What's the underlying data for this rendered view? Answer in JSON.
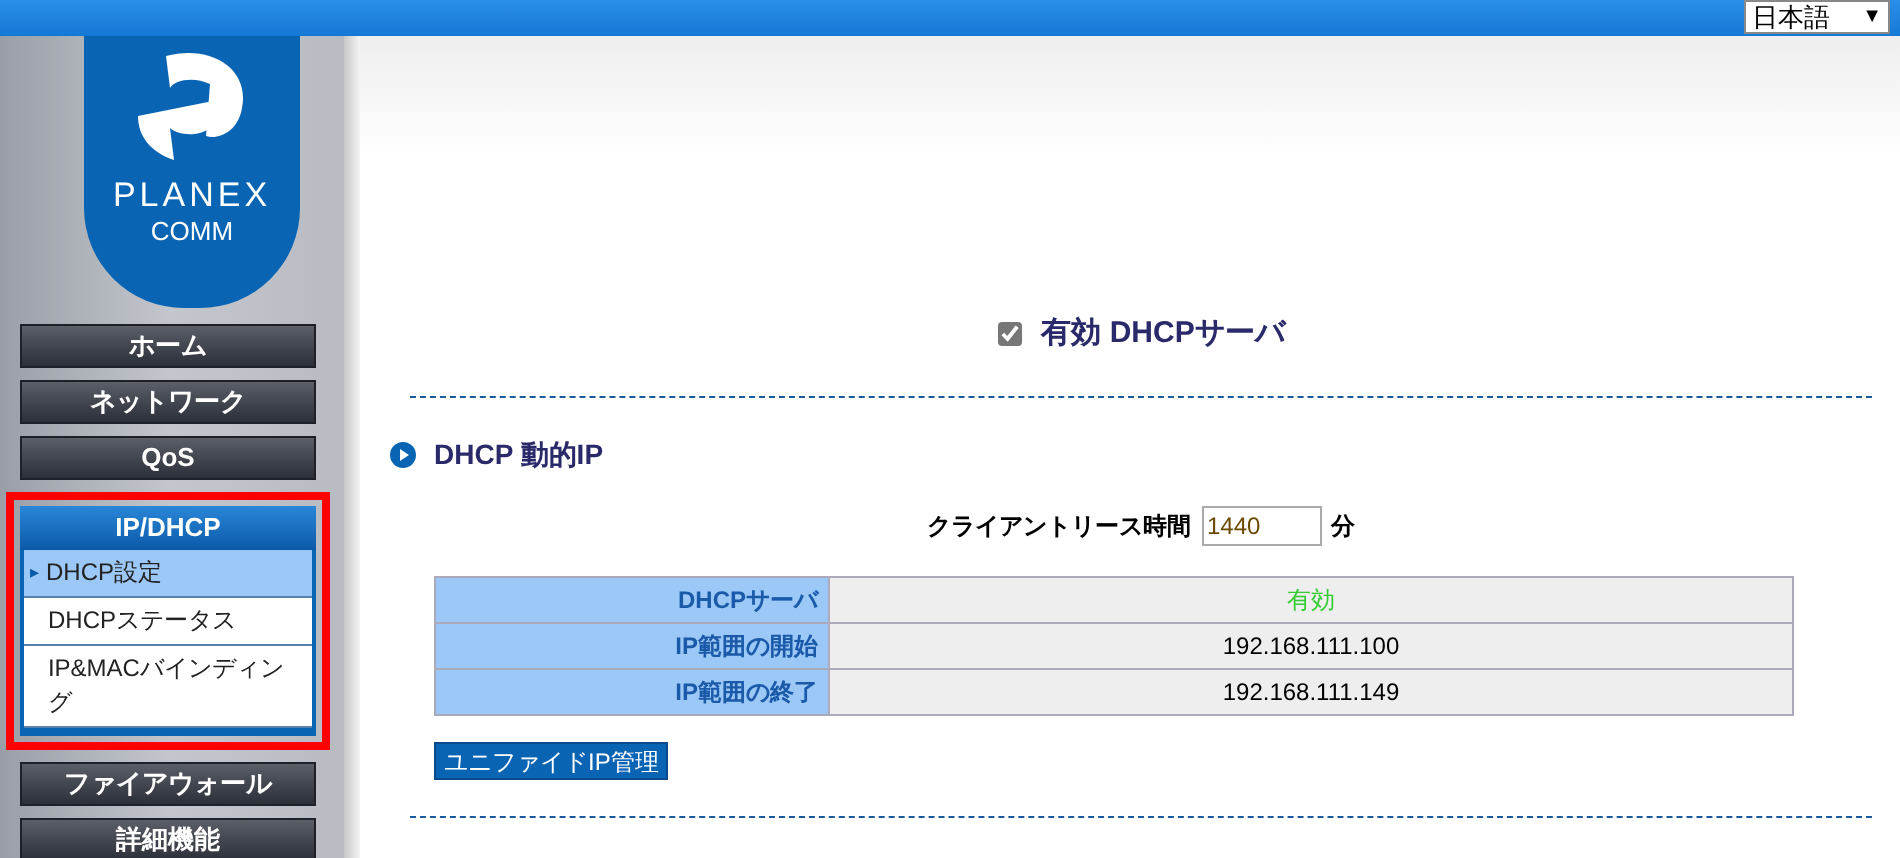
{
  "language_select": {
    "value": "日本語",
    "arrow": "▼"
  },
  "logo": {
    "line1": "PLANEX",
    "line2": "COMM"
  },
  "nav": [
    {
      "label": "ホーム",
      "kind": "button"
    },
    {
      "label": "ネットワーク",
      "kind": "button"
    },
    {
      "label": "QoS",
      "kind": "button"
    },
    {
      "label": "IP/DHCP",
      "kind": "group",
      "highlighted": true,
      "children": [
        {
          "label": "DHCP設定",
          "selected": true,
          "marker": "▸"
        },
        {
          "label": "DHCPステータス",
          "selected": false
        },
        {
          "label": "IP&MACバインディング",
          "selected": false
        }
      ]
    },
    {
      "label": "ファイアウォール",
      "kind": "button"
    },
    {
      "label": "詳細機能",
      "kind": "button"
    }
  ],
  "enable_dhcp": {
    "label": "有効 DHCPサーバ",
    "checked": true
  },
  "section": {
    "title": "DHCP 動的IP"
  },
  "lease": {
    "label": "クライアントリース時間",
    "value": "1440",
    "unit": "分"
  },
  "table": {
    "rows": [
      {
        "label": "DHCPサーバ",
        "value": "有効",
        "color": "#33cc33"
      },
      {
        "label": "IP範囲の開始",
        "value": "192.168.111.100",
        "color": "#000000"
      },
      {
        "label": "IP範囲の終了",
        "value": "192.168.111.149",
        "color": "#000000"
      }
    ]
  },
  "unified_button": {
    "label": "ユニファイドIP管理"
  }
}
